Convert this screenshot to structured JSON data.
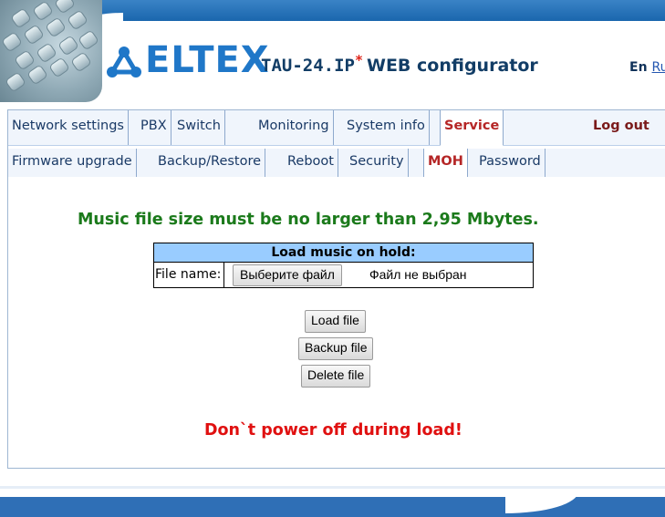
{
  "header": {
    "brand": "ELTEX",
    "model": "TAU-24.IP",
    "star": "*",
    "title_suffix": "WEB configurator",
    "lang_en": "En",
    "lang_ru": "Ru"
  },
  "nav_primary": {
    "tabs": [
      {
        "label": "Network settings",
        "active": false
      },
      {
        "label": "PBX",
        "active": false
      },
      {
        "label": "Switch",
        "active": false
      },
      {
        "label": "Monitoring",
        "active": false
      },
      {
        "label": "System info",
        "active": false
      },
      {
        "label": "Service",
        "active": true
      }
    ],
    "logout": "Log out"
  },
  "nav_secondary": {
    "tabs": [
      {
        "label": "Firmware upgrade",
        "active": false
      },
      {
        "label": "Backup/Restore",
        "active": false
      },
      {
        "label": "Reboot",
        "active": false
      },
      {
        "label": "Security",
        "active": false
      },
      {
        "label": "MOH",
        "active": true
      },
      {
        "label": "Password",
        "active": false
      }
    ]
  },
  "moh": {
    "size_warning": "Music file size must be no larger than 2,95 Mbytes.",
    "table_title": "Load music on hold:",
    "file_label": "File name:",
    "choose_button": "Выберите файл",
    "file_status": "Файл не выбран",
    "load_button": "Load file",
    "backup_button": "Backup file",
    "delete_button": "Delete file",
    "power_warning": "Don`t power off during load!"
  },
  "colors": {
    "accent_blue": "#1f77c8",
    "active_tab": "#b52626",
    "warning_green": "#1b7a1b",
    "warning_red": "#e01010",
    "table_header": "#99ccff"
  }
}
